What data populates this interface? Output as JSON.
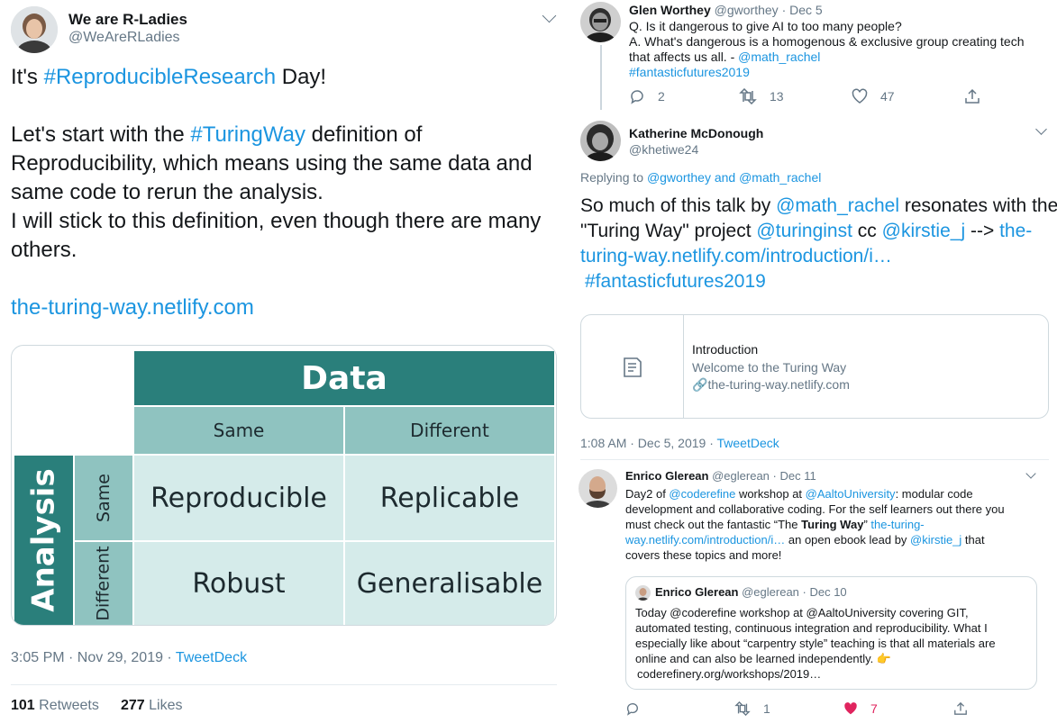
{
  "left_tweet": {
    "display_name": "We are R-Ladies",
    "handle": "@WeAreRLadies",
    "line1_prefix": "It's ",
    "line1_tag": "#ReproducibleResearch",
    "line1_suffix": " Day!",
    "line2_prefix": "Let's start with the ",
    "line2_tag": "#TuringWay",
    "line2_suffix": " definition of",
    "line3": "Reproducibility, which means using the same data and",
    "line4": "same code to rerun the analysis.",
    "line5": "I will stick to this definition, even though there are many",
    "line6": "others.",
    "link": "the-turing-way.netlify.com",
    "timestamp": "3:05 PM · Nov 29, 2019 · ",
    "source": "TweetDeck",
    "retweets_count": "101",
    "retweets_label": " Retweets",
    "likes_count": "277",
    "likes_label": " Likes"
  },
  "reproducibility_table": {
    "col_header": "Data",
    "col_same": "Same",
    "col_different": "Different",
    "row_header": "Analysis",
    "row_same": "Same",
    "row_different": "Different",
    "cell_same_same": "Reproducible",
    "cell_same_diff": "Replicable",
    "cell_diff_same": "Robust",
    "cell_diff_diff": "Generalisable",
    "colors": {
      "dark_teal": "#2a7f7b",
      "mid_teal": "#8fc3c0",
      "light_teal": "#d5ebea"
    }
  },
  "tweet_glen": {
    "display_name": "Glen Worthey",
    "handle": "@gworthey",
    "date": " · Dec 5",
    "line1": "Q. Is it dangerous to give AI to too many people?",
    "line2": "A. What's dangerous is a homogenous & exclusive group creating tech",
    "line3_prefix": "that affects us all. - ",
    "line3_mention": "@math_rachel",
    "line4_tag": "#fantasticfutures2019",
    "replies": "2",
    "retweets": "13",
    "likes": "47"
  },
  "tweet_katherine": {
    "display_name": "Katherine McDonough",
    "handle": "@khetiwe24",
    "replying_prefix": "Replying to ",
    "replying_to": "@gworthey and @math_rachel",
    "l1_prefix": "So much of this talk by ",
    "l1_mention": "@math_rachel",
    "l1_suffix": " resonates with the",
    "l2_prefix": "\"Turing Way\" project ",
    "l2_mention1": "@turinginst",
    "l2_mid": " cc ",
    "l2_mention2": "@kirstie_j",
    "l2_arrow": " --> ",
    "l2_link": "the-",
    "l3_link": "turing-way.netlify.com/introduction/i…",
    "l4_tag": "#fantasticfutures2019",
    "card_title": "Introduction",
    "card_desc": "Welcome to the Turing Way",
    "card_url": "the-turing-way.netlify.com",
    "timestamp": "1:08 AM · Dec 5, 2019 · ",
    "source": "TweetDeck"
  },
  "tweet_enrico": {
    "display_name": "Enrico Glerean",
    "handle": "@eglerean",
    "date": " · Dec 11",
    "l1_a": "Day2 of ",
    "l1_m1": "@coderefine",
    "l1_b": " workshop at ",
    "l1_m2": "@AaltoUniversity",
    "l1_c": ": modular code",
    "l2": "development and collaborative coding. For the self learners out there you",
    "l3_a": "must check out the fantastic “The ",
    "l3_bold": "Turing Way",
    "l3_b": "” ",
    "l3_link": "the-turing-",
    "l4_link": "way.netlify.com/introduction/i…",
    "l4_a": " an open ebook lead by ",
    "l4_mention": "@kirstie_j",
    "l4_b": " that",
    "l5": "covers these topics and more!",
    "quote_name": "Enrico Glerean",
    "quote_handle": "@eglerean",
    "quote_date": " · Dec 10",
    "quote_l1": "Today @coderefine workshop at @AaltoUniversity covering GIT,",
    "quote_l2": "automated testing, continuous integration and reproducibility. What I",
    "quote_l3": "especially like about “carpentry style” teaching is that all materials are",
    "quote_l4": "online and can also be learned independently. 👉",
    "quote_l5": "coderefinery.org/workshops/2019…",
    "retweets": "1",
    "likes": "7",
    "like_color": "#e0245e"
  }
}
